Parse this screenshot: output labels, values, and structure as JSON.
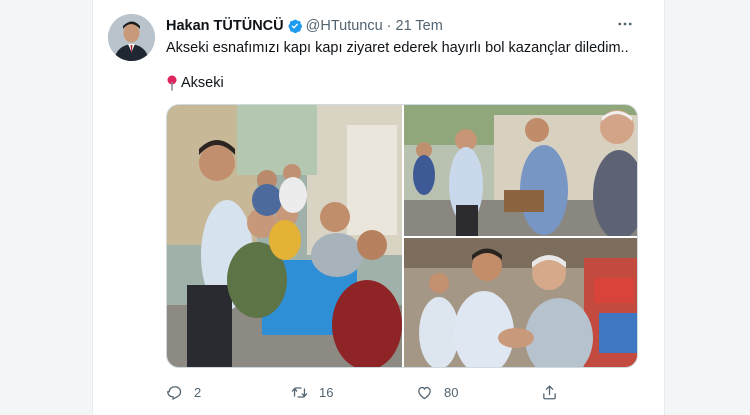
{
  "tweet": {
    "author_name": "Hakan TÜTÜNCÜ",
    "handle": "@HTutuncu",
    "separator": "·",
    "date": "21 Tem",
    "text": "Akseki esnafımızı kapı kapı ziyaret ederek hayırlı bol kazançlar diledim..",
    "location": "Akseki",
    "verified": true
  },
  "actions": {
    "reply_count": "2",
    "retweet_count": "16",
    "like_count": "80"
  },
  "colors": {
    "verified_blue": "#1d9bf0",
    "pin_red": "#e0245e",
    "secondary_text": "#536471"
  },
  "icons": [
    "verified-icon",
    "more-icon",
    "pin-icon",
    "reply-icon",
    "retweet-icon",
    "like-icon",
    "share-icon"
  ]
}
